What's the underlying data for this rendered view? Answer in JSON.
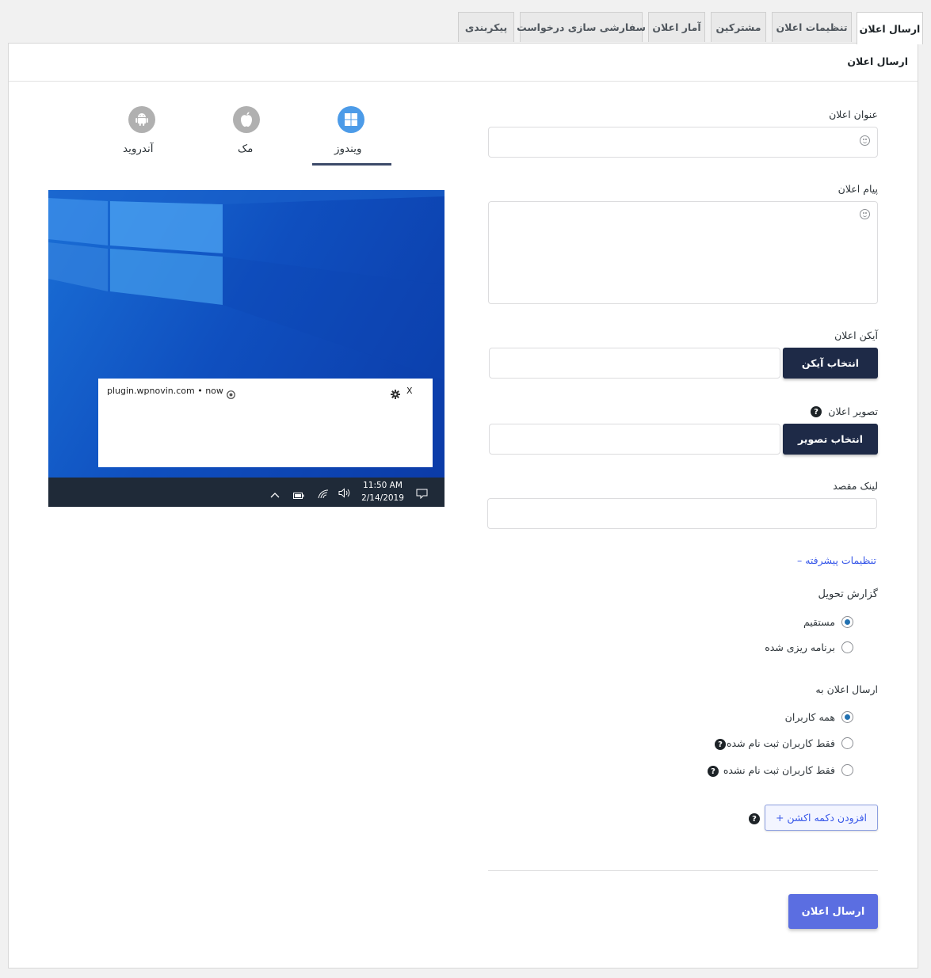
{
  "tabs": [
    {
      "label": "ارسال اعلان",
      "active": true
    },
    {
      "label": "تنظیمات اعلان",
      "active": false
    },
    {
      "label": "مشترکین",
      "active": false
    },
    {
      "label": "آمار اعلان",
      "active": false
    },
    {
      "label": "سفارشی سازی درخواست",
      "active": false
    },
    {
      "label": "پیکربندی",
      "active": false
    }
  ],
  "panel": {
    "title": "ارسال اعلان"
  },
  "form": {
    "title_label": "عنوان اعلان",
    "message_label": "پیام اعلان",
    "icon_label": "آیکن اعلان",
    "icon_button": "انتخاب آیکن",
    "image_label": "تصویر اعلان",
    "image_button": "انتخاب تصویر",
    "link_label": "لینک مقصد",
    "advanced_toggle": "– تنظیمات پیشرفته",
    "delivery_label": "گزارش تحویل",
    "delivery_options": [
      "مستقیم",
      "برنامه ریزی شده"
    ],
    "delivery_selected": 0,
    "send_to_label": "ارسال اعلان به",
    "send_to_options": [
      "همه کاربران",
      "فقط کاربران ثبت نام شده",
      "فقط کاربران ثبت نام نشده"
    ],
    "send_to_selected": 0,
    "add_action_button": "+ افزودن دکمه اکشن",
    "submit_button": "ارسال اعلان"
  },
  "preview": {
    "platforms": [
      {
        "label": "ویندوز",
        "icon": "windows-icon",
        "active": true
      },
      {
        "label": "مک",
        "icon": "apple-icon",
        "active": false
      },
      {
        "label": "آندروید",
        "icon": "android-icon",
        "active": false
      }
    ],
    "notification_source": "plugin.wpnovin.com • now",
    "close_glyph": "X",
    "taskbar_time": "11:50 AM",
    "taskbar_date": "2/14/2019"
  },
  "colors": {
    "accent": "#4c9be8",
    "dark_button": "#1e2a47",
    "submit": "#5b6ee1",
    "radio_selected": "#2271b1"
  }
}
